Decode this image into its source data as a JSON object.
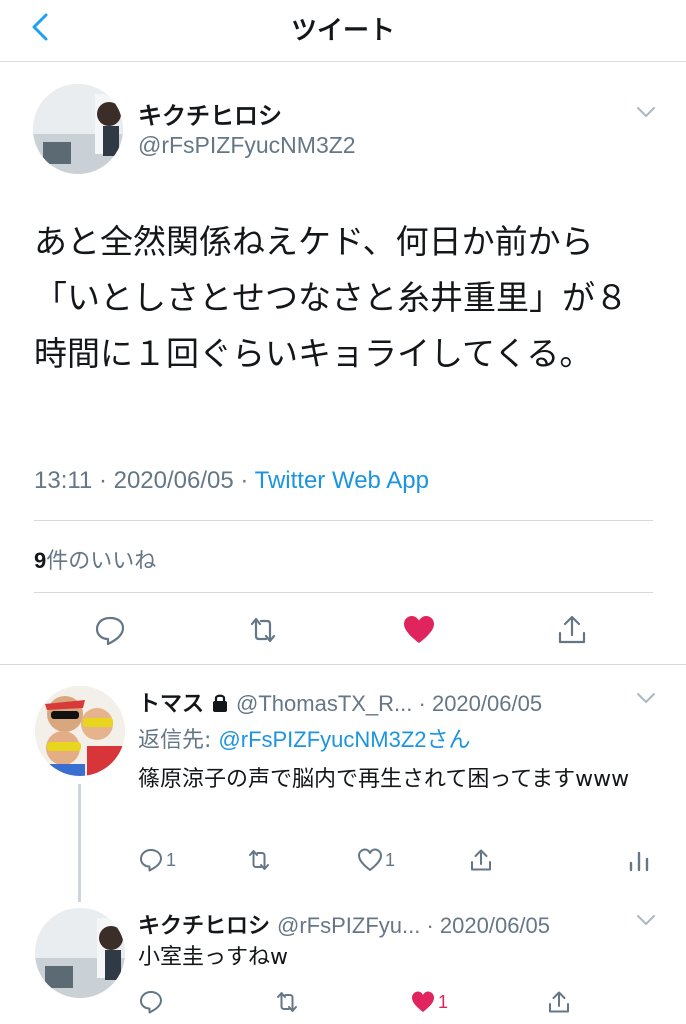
{
  "header": {
    "title": "ツイート"
  },
  "tweet": {
    "author_name": "キクチヒロシ",
    "author_handle": "@rFsPIZFyucNM3Z2",
    "text": "あと全然関係ねえケド、何日か前から「いとしさとせつなさと糸井重里」が８時間に１回ぐらいキョライしてくる。",
    "time": "13:11 · 2020/06/05 · ",
    "source": "Twitter Web App",
    "likes_count": "9",
    "likes_label": "件のいいね"
  },
  "replies": [
    {
      "author_name": "トマス",
      "author_handle": "@ThomasTX_R...",
      "date": " · 2020/06/05",
      "replying_label": "返信先: ",
      "replying_to": "@rFsPIZFyucNM3Z2さん",
      "text": "篠原涼子の声で脳内で再生されて困ってますwww",
      "reply_count": "1",
      "like_count": "1"
    },
    {
      "author_name": "キクチヒロシ",
      "author_handle": "@rFsPIZFyu...",
      "date": " · 2020/06/05",
      "text": "小室圭っすねw",
      "like_count": "1"
    }
  ],
  "colors": {
    "accent": "#1b95e0",
    "like": "#e0245e",
    "muted": "#657786",
    "divider": "#d6dadd"
  },
  "icons": [
    "back-chevron-icon",
    "chevron-down-icon",
    "reply-icon",
    "retweet-icon",
    "heart-icon",
    "share-icon",
    "lock-icon",
    "analytics-icon"
  ]
}
